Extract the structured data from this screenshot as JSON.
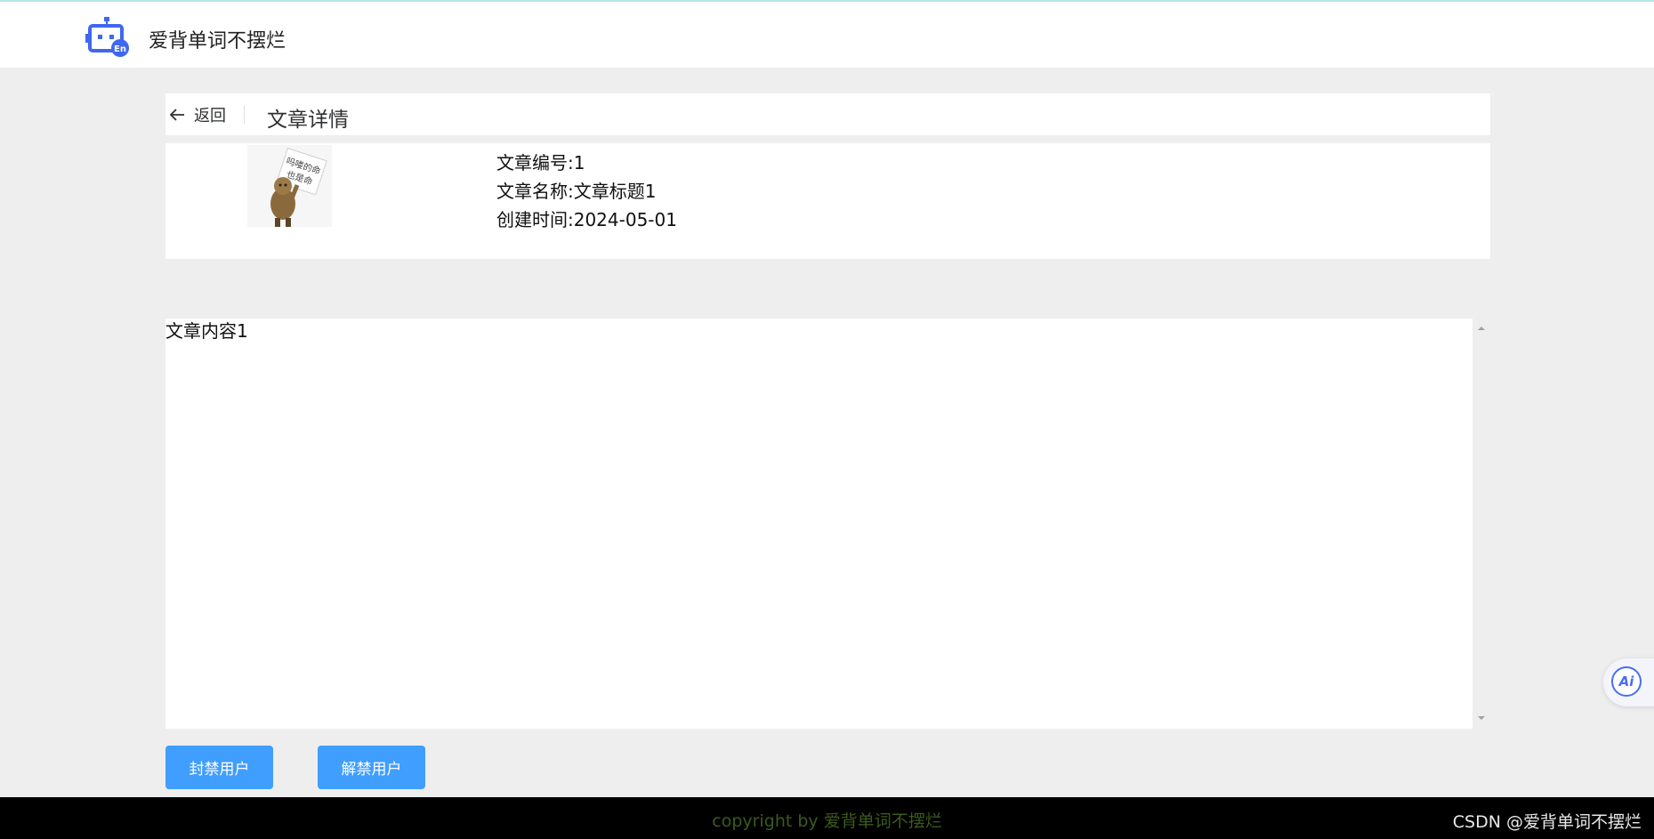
{
  "app": {
    "title": "爱背单词不摆烂",
    "logo_icon": "robot-en-icon"
  },
  "page_header": {
    "back_label": "返回",
    "title": "文章详情"
  },
  "article": {
    "id_line": "文章编号:1",
    "name_line": "文章名称:文章标题1",
    "created_line": "创建时间:2024-05-01",
    "cover_caption_line1": "吗喽的命",
    "cover_caption_line2": "也是命",
    "content": "文章内容1"
  },
  "actions": {
    "ban_label": "封禁用户",
    "unban_label": "解禁用户"
  },
  "footer": {
    "copyright": "copyright by 爱背单词不摆烂",
    "watermark": "CSDN @爱背单词不摆烂"
  },
  "floating": {
    "ai_label": "Ai"
  },
  "colors": {
    "primary": "#409eff",
    "page_bg": "#eeeeee",
    "footer_bg": "#000000",
    "logo": "#3f67f0"
  }
}
